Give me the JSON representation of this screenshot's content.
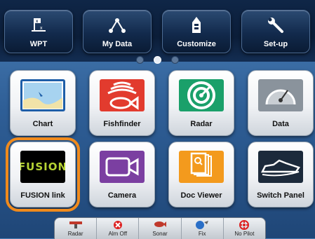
{
  "top_nav": [
    {
      "label": "WPT",
      "icon": "waypoint-icon"
    },
    {
      "label": "My Data",
      "icon": "route-icon"
    },
    {
      "label": "Customize",
      "icon": "boat-icon"
    },
    {
      "label": "Set-up",
      "icon": "wrench-icon"
    }
  ],
  "page_indicator": {
    "count": 3,
    "active": 2
  },
  "apps": [
    {
      "label": "Chart",
      "icon": "chart-icon"
    },
    {
      "label": "Fishfinder",
      "icon": "fishfinder-icon"
    },
    {
      "label": "Radar",
      "icon": "radar-icon"
    },
    {
      "label": "Data",
      "icon": "gauge-icon"
    },
    {
      "label": "FUSION link",
      "icon": "fusion-icon",
      "logo_text": "FUSION",
      "selected": true
    },
    {
      "label": "Camera",
      "icon": "camera-icon"
    },
    {
      "label": "Doc Viewer",
      "icon": "document-icon"
    },
    {
      "label": "Switch Panel",
      "icon": "speedboat-icon"
    }
  ],
  "dock": [
    {
      "label": "Radar",
      "icon": "radar-dock-icon"
    },
    {
      "label": "Alm Off",
      "icon": "alarm-off-icon"
    },
    {
      "label": "Sonar",
      "icon": "sonar-icon"
    },
    {
      "label": "Fix",
      "icon": "gps-fix-icon"
    },
    {
      "label": "No Pilot",
      "icon": "pilot-icon"
    }
  ],
  "colors": {
    "selection": "#f08a1c",
    "topbar": "#0b1d38",
    "background": "#2f5f97"
  }
}
